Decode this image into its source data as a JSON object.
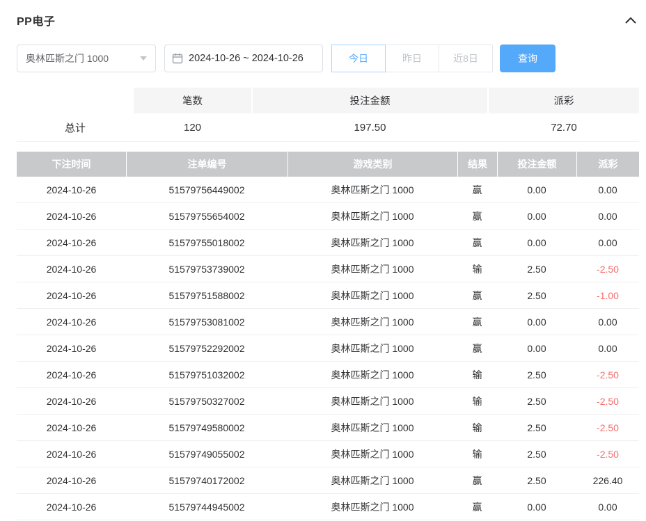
{
  "header": {
    "title": "PP电子"
  },
  "filters": {
    "game_select": {
      "value": "奥林匹斯之门 1000"
    },
    "date_range": {
      "value": "2024-10-26 ~ 2024-10-26"
    },
    "quick_buttons": [
      {
        "label": "今日",
        "active": true
      },
      {
        "label": "昨日",
        "active": false
      },
      {
        "label": "近8日",
        "active": false
      }
    ],
    "search_button_label": "查询"
  },
  "summary": {
    "columns": {
      "count": "笔数",
      "bet_amount": "投注金额",
      "payout": "派彩"
    },
    "row": {
      "label": "总计",
      "count": "120",
      "bet_amount": "197.50",
      "payout": "72.70"
    }
  },
  "table": {
    "columns": [
      "下注时间",
      "注单编号",
      "游戏类别",
      "结果",
      "投注金额",
      "派彩"
    ],
    "rows": [
      {
        "date": "2024-10-26",
        "order_id": "51579756449002",
        "game": "奥林匹斯之门 1000",
        "result": "赢",
        "bet": "0.00",
        "payout": "0.00"
      },
      {
        "date": "2024-10-26",
        "order_id": "51579755654002",
        "game": "奥林匹斯之门 1000",
        "result": "赢",
        "bet": "0.00",
        "payout": "0.00"
      },
      {
        "date": "2024-10-26",
        "order_id": "51579755018002",
        "game": "奥林匹斯之门 1000",
        "result": "赢",
        "bet": "0.00",
        "payout": "0.00"
      },
      {
        "date": "2024-10-26",
        "order_id": "51579753739002",
        "game": "奥林匹斯之门 1000",
        "result": "输",
        "bet": "2.50",
        "payout": "-2.50"
      },
      {
        "date": "2024-10-26",
        "order_id": "51579751588002",
        "game": "奥林匹斯之门 1000",
        "result": "赢",
        "bet": "2.50",
        "payout": "-1.00"
      },
      {
        "date": "2024-10-26",
        "order_id": "51579753081002",
        "game": "奥林匹斯之门 1000",
        "result": "赢",
        "bet": "0.00",
        "payout": "0.00"
      },
      {
        "date": "2024-10-26",
        "order_id": "51579752292002",
        "game": "奥林匹斯之门 1000",
        "result": "赢",
        "bet": "0.00",
        "payout": "0.00"
      },
      {
        "date": "2024-10-26",
        "order_id": "51579751032002",
        "game": "奥林匹斯之门 1000",
        "result": "输",
        "bet": "2.50",
        "payout": "-2.50"
      },
      {
        "date": "2024-10-26",
        "order_id": "51579750327002",
        "game": "奥林匹斯之门 1000",
        "result": "输",
        "bet": "2.50",
        "payout": "-2.50"
      },
      {
        "date": "2024-10-26",
        "order_id": "51579749580002",
        "game": "奥林匹斯之门 1000",
        "result": "输",
        "bet": "2.50",
        "payout": "-2.50"
      },
      {
        "date": "2024-10-26",
        "order_id": "51579749055002",
        "game": "奥林匹斯之门 1000",
        "result": "输",
        "bet": "2.50",
        "payout": "-2.50"
      },
      {
        "date": "2024-10-26",
        "order_id": "51579740172002",
        "game": "奥林匹斯之门 1000",
        "result": "赢",
        "bet": "2.50",
        "payout": "226.40"
      },
      {
        "date": "2024-10-26",
        "order_id": "51579744945002",
        "game": "奥林匹斯之门 1000",
        "result": "赢",
        "bet": "0.00",
        "payout": "0.00"
      }
    ]
  },
  "colors": {
    "accent": "#53a8ff",
    "search_button_bg": "#55a9fa",
    "table_header_bg": "#c8c9cb",
    "negative": "#f56c6c"
  }
}
